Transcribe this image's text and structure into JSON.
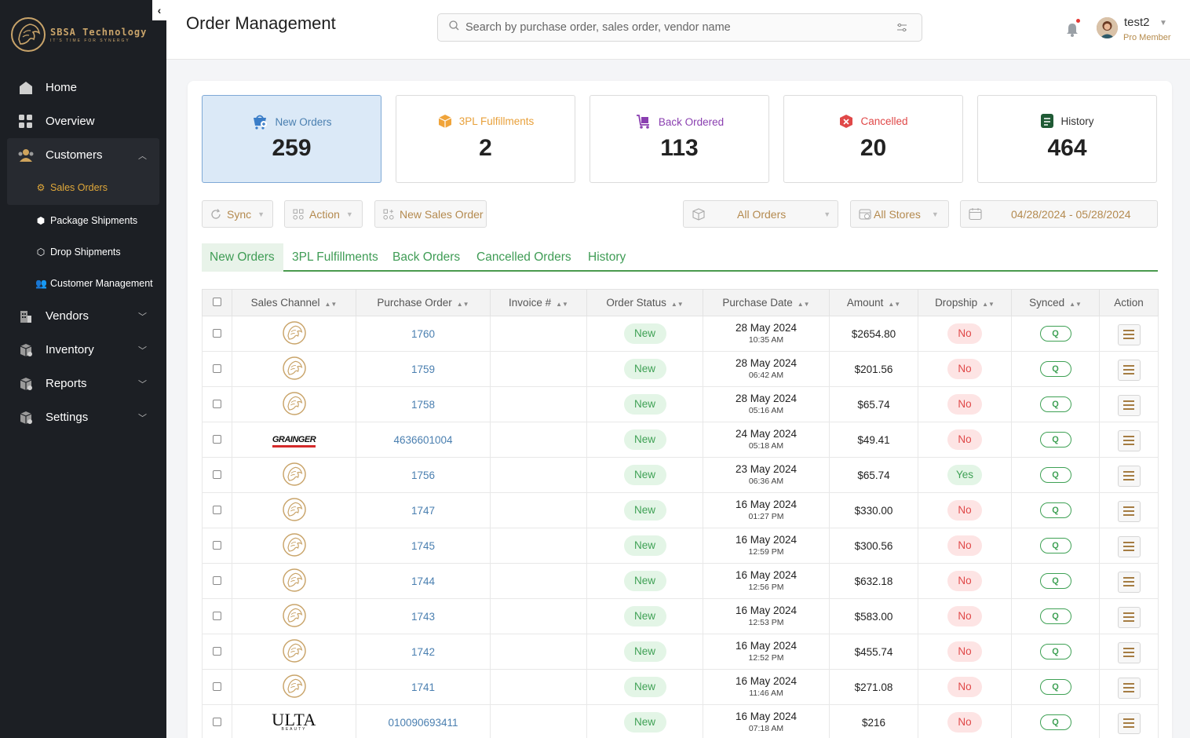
{
  "app": {
    "brand_name": "SBSA Technology",
    "brand_tag": "IT'S TIME FOR SYNERGY",
    "collapse_icon": "chevron-left-icon"
  },
  "sidebar": {
    "items": [
      {
        "label": "Home",
        "icon": "home-icon"
      },
      {
        "label": "Overview",
        "icon": "grid-icon"
      },
      {
        "label": "Customers",
        "icon": "users-icon",
        "expanded": true,
        "children": [
          {
            "label": "Sales Orders",
            "icon": "gear-badge-icon",
            "active": true
          }
        ]
      },
      {
        "label": "Package Shipments",
        "icon": "box-icon"
      },
      {
        "label": "Drop Shipments",
        "icon": "boxes-icon"
      },
      {
        "label": "Customer Management",
        "icon": "people-icon"
      },
      {
        "label": "Vendors",
        "icon": "building-icon"
      },
      {
        "label": "Inventory",
        "icon": "inventory-icon"
      },
      {
        "label": "Reports",
        "icon": "reports-icon"
      },
      {
        "label": "Settings",
        "icon": "settings-icon"
      }
    ]
  },
  "header": {
    "title": "Order Management",
    "search_placeholder": "Search by purchase order, sales order, vendor name",
    "user_name": "test2",
    "user_role": "Pro Member",
    "notification_dot_color": "#e53935"
  },
  "cards": [
    {
      "label": "New Orders",
      "value": "259",
      "color": "#4a7fb0",
      "active": true
    },
    {
      "label": "3PL Fulfillments",
      "value": "2",
      "color": "#e8a03a"
    },
    {
      "label": "Back Ordered",
      "value": "113",
      "color": "#8a3fb0"
    },
    {
      "label": "Cancelled",
      "value": "20",
      "color": "#e04848"
    },
    {
      "label": "History",
      "value": "464",
      "color": "#333333"
    }
  ],
  "toolbar": {
    "sync": "Sync",
    "action": "Action",
    "new_sales_order": "New Sales Order",
    "orders_filter": "All Orders",
    "stores_filter": "All Stores",
    "date_range": "04/28/2024 - 05/28/2024"
  },
  "tabs": [
    "New Orders",
    "3PL Fulfillments",
    "Back Orders",
    "Cancelled Orders",
    "History"
  ],
  "table": {
    "columns": [
      "Sales Channel",
      "Purchase Order",
      "Invoice #",
      "Order Status",
      "Purchase Date",
      "Amount",
      "Dropship",
      "Synced",
      "Action"
    ],
    "rows": [
      {
        "channel": "sbsa",
        "po": "1760",
        "invoice": "",
        "status": "New",
        "date": "28 May 2024",
        "time": "10:35 AM",
        "amount": "$2654.80",
        "dropship": "No",
        "synced": "Q"
      },
      {
        "channel": "sbsa",
        "po": "1759",
        "invoice": "",
        "status": "New",
        "date": "28 May 2024",
        "time": "06:42 AM",
        "amount": "$201.56",
        "dropship": "No",
        "synced": "Q"
      },
      {
        "channel": "sbsa",
        "po": "1758",
        "invoice": "",
        "status": "New",
        "date": "28 May 2024",
        "time": "05:16 AM",
        "amount": "$65.74",
        "dropship": "No",
        "synced": "Q"
      },
      {
        "channel": "grainger",
        "po": "4636601004",
        "invoice": "",
        "status": "New",
        "date": "24 May 2024",
        "time": "05:18 AM",
        "amount": "$49.41",
        "dropship": "No",
        "synced": "Q"
      },
      {
        "channel": "sbsa",
        "po": "1756",
        "invoice": "",
        "status": "New",
        "date": "23 May 2024",
        "time": "06:36 AM",
        "amount": "$65.74",
        "dropship": "Yes",
        "synced": "Q"
      },
      {
        "channel": "sbsa",
        "po": "1747",
        "invoice": "",
        "status": "New",
        "date": "16 May 2024",
        "time": "01:27 PM",
        "amount": "$330.00",
        "dropship": "No",
        "synced": "Q"
      },
      {
        "channel": "sbsa",
        "po": "1745",
        "invoice": "",
        "status": "New",
        "date": "16 May 2024",
        "time": "12:59 PM",
        "amount": "$300.56",
        "dropship": "No",
        "synced": "Q"
      },
      {
        "channel": "sbsa",
        "po": "1744",
        "invoice": "",
        "status": "New",
        "date": "16 May 2024",
        "time": "12:56 PM",
        "amount": "$632.18",
        "dropship": "No",
        "synced": "Q"
      },
      {
        "channel": "sbsa",
        "po": "1743",
        "invoice": "",
        "status": "New",
        "date": "16 May 2024",
        "time": "12:53 PM",
        "amount": "$583.00",
        "dropship": "No",
        "synced": "Q"
      },
      {
        "channel": "sbsa",
        "po": "1742",
        "invoice": "",
        "status": "New",
        "date": "16 May 2024",
        "time": "12:52 PM",
        "amount": "$455.74",
        "dropship": "No",
        "synced": "Q"
      },
      {
        "channel": "sbsa",
        "po": "1741",
        "invoice": "",
        "status": "New",
        "date": "16 May 2024",
        "time": "11:46 AM",
        "amount": "$271.08",
        "dropship": "No",
        "synced": "Q"
      },
      {
        "channel": "ulta",
        "po": "010090693411",
        "invoice": "",
        "status": "New",
        "date": "16 May 2024",
        "time": "07:18 AM",
        "amount": "$216",
        "dropship": "No",
        "synced": "Q"
      }
    ]
  },
  "channel_logos": {
    "grainger": "GRAINGER",
    "ulta": "ULTA",
    "ulta_sub": "BEAUTY"
  },
  "theme": {
    "accent": "#b48a4f",
    "green": "#3fa155",
    "red": "#e04848",
    "link": "#4a7fb0"
  }
}
